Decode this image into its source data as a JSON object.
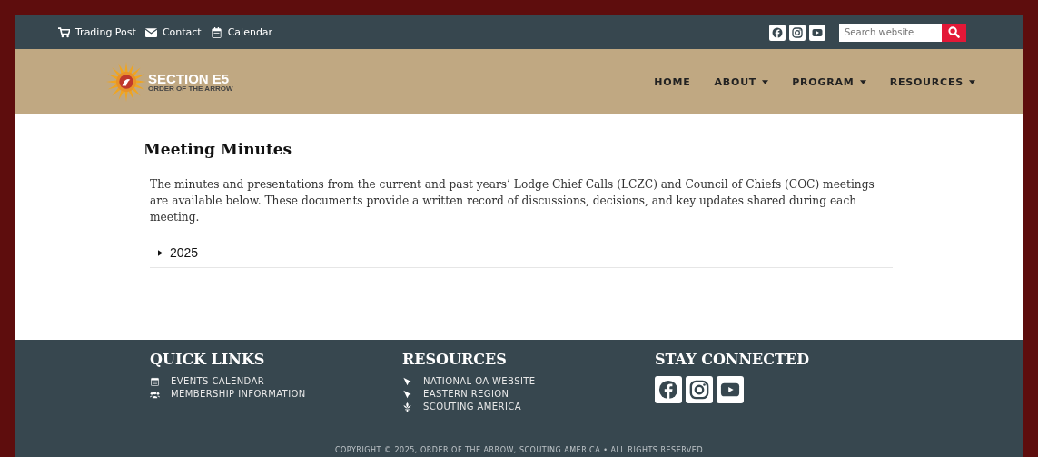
{
  "top_bar": {
    "links": [
      {
        "kind": "cart",
        "label": "Trading Post"
      },
      {
        "kind": "mail",
        "label": "Contact"
      },
      {
        "kind": "calendar",
        "label": "Calendar"
      }
    ],
    "social": [
      {
        "kind": "facebook"
      },
      {
        "kind": "instagram"
      },
      {
        "kind": "youtube"
      }
    ],
    "search": {
      "placeholder": "Search website"
    }
  },
  "header": {
    "logo": {
      "title": "SECTION E5",
      "subtitle": "ORDER OF THE ARROW"
    },
    "nav": [
      {
        "label": "HOME",
        "dropdown": false
      },
      {
        "label": "ABOUT",
        "dropdown": true
      },
      {
        "label": "PROGRAM",
        "dropdown": true
      },
      {
        "label": "RESOURCES",
        "dropdown": true
      }
    ]
  },
  "content": {
    "title": "Meeting Minutes",
    "intro": "The minutes and presentations from the current and past years’ Lodge Chief Calls (LCZC) and Council of Chiefs (COC) meetings are available below. These documents provide a written record of discussions, decisions, and key updates shared during each meeting.",
    "sections": [
      {
        "label": "2025",
        "expanded": false
      }
    ]
  },
  "footer": {
    "columns": [
      {
        "kind": "links",
        "title": "QUICK LINKS",
        "items": [
          {
            "kind": "calendar",
            "label": "EVENTS CALENDAR"
          },
          {
            "kind": "users",
            "label": "MEMBERSHIP INFORMATION"
          }
        ]
      },
      {
        "kind": "links",
        "title": "RESOURCES",
        "items": [
          {
            "kind": "arrow",
            "label": "NATIONAL OA WEBSITE"
          },
          {
            "kind": "arrow",
            "label": "EASTERN REGION"
          },
          {
            "kind": "fleur",
            "label": "SCOUTING AMERICA"
          }
        ]
      },
      {
        "kind": "social",
        "title": "STAY CONNECTED",
        "items": [
          {
            "kind": "facebook"
          },
          {
            "kind": "instagram"
          },
          {
            "kind": "youtube"
          }
        ]
      }
    ],
    "copyright": "COPYRIGHT © 2025, ORDER OF THE ARROW, SCOUTING AMERICA • ALL RIGHTS RESERVED"
  }
}
